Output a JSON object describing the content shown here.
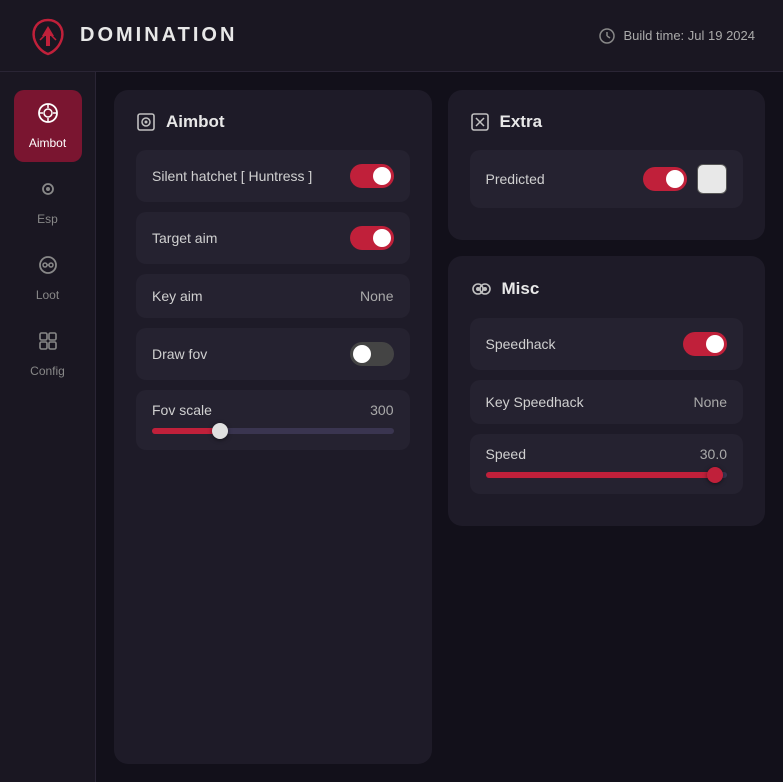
{
  "header": {
    "logo_text": "DOMINATION",
    "build_label": "Build time: Jul 19 2024"
  },
  "sidebar": {
    "items": [
      {
        "id": "aimbot",
        "label": "Aimbot",
        "icon": "🎯",
        "active": true
      },
      {
        "id": "esp",
        "label": "Esp",
        "icon": "👁",
        "active": false
      },
      {
        "id": "loot",
        "label": "Loot",
        "icon": "📡",
        "active": false
      },
      {
        "id": "config",
        "label": "Config",
        "icon": "📦",
        "active": false
      }
    ]
  },
  "aimbot_panel": {
    "title": "Aimbot",
    "settings": [
      {
        "id": "silent_hatchet",
        "label": "Silent hatchet [ Huntress ]",
        "type": "toggle",
        "value": true
      },
      {
        "id": "target_aim",
        "label": "Target aim",
        "type": "toggle",
        "value": true
      },
      {
        "id": "key_aim",
        "label": "Key aim",
        "type": "value",
        "value": "None"
      },
      {
        "id": "draw_fov",
        "label": "Draw fov",
        "type": "toggle",
        "value": false
      }
    ],
    "fov_scale": {
      "label": "Fov scale",
      "value": "300",
      "percent": 28
    }
  },
  "extra_panel": {
    "title": "Extra",
    "predicted": {
      "label": "Predicted",
      "toggle_on": true,
      "color": "#e8e8e8"
    }
  },
  "misc_panel": {
    "title": "Misc",
    "settings": [
      {
        "id": "speedhack",
        "label": "Speedhack",
        "type": "toggle",
        "value": true
      },
      {
        "id": "key_speedhack",
        "label": "Key Speedhack",
        "type": "value",
        "value": "None"
      }
    ],
    "speed": {
      "label": "Speed",
      "value": "30.0",
      "percent": 95
    }
  }
}
